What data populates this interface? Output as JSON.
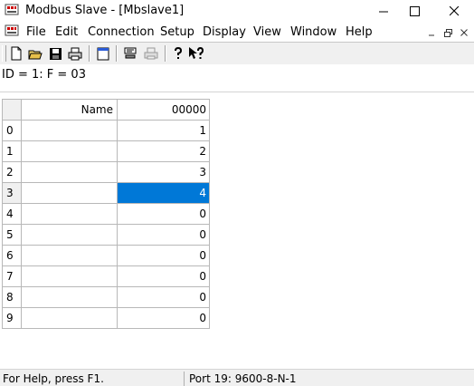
{
  "window": {
    "title": "Modbus Slave - [Mbslave1]"
  },
  "menu": {
    "items": [
      "File",
      "Edit",
      "Connection",
      "Setup",
      "Display",
      "View",
      "Window",
      "Help"
    ]
  },
  "toolbar": {
    "buttons": [
      "new-icon",
      "open-icon",
      "save-icon",
      "print-icon",
      "window-icon",
      "register-icon",
      "printer-disabled-icon",
      "help-icon",
      "context-help-icon"
    ]
  },
  "document": {
    "info": "ID = 1: F = 03",
    "grid": {
      "name_header": "Name",
      "value_header": "00000",
      "selected_row": 3,
      "rows": [
        {
          "index": "0",
          "name": "",
          "value": "1"
        },
        {
          "index": "1",
          "name": "",
          "value": "2"
        },
        {
          "index": "2",
          "name": "",
          "value": "3"
        },
        {
          "index": "3",
          "name": "",
          "value": "4"
        },
        {
          "index": "4",
          "name": "",
          "value": "0"
        },
        {
          "index": "5",
          "name": "",
          "value": "0"
        },
        {
          "index": "6",
          "name": "",
          "value": "0"
        },
        {
          "index": "7",
          "name": "",
          "value": "0"
        },
        {
          "index": "8",
          "name": "",
          "value": "0"
        },
        {
          "index": "9",
          "name": "",
          "value": "0"
        }
      ]
    }
  },
  "status": {
    "help": "For Help, press F1.",
    "port": "Port 19: 9600-8-N-1"
  },
  "colors": {
    "selection": "#0078d7",
    "toolbar_bg": "#f0f0f0"
  }
}
